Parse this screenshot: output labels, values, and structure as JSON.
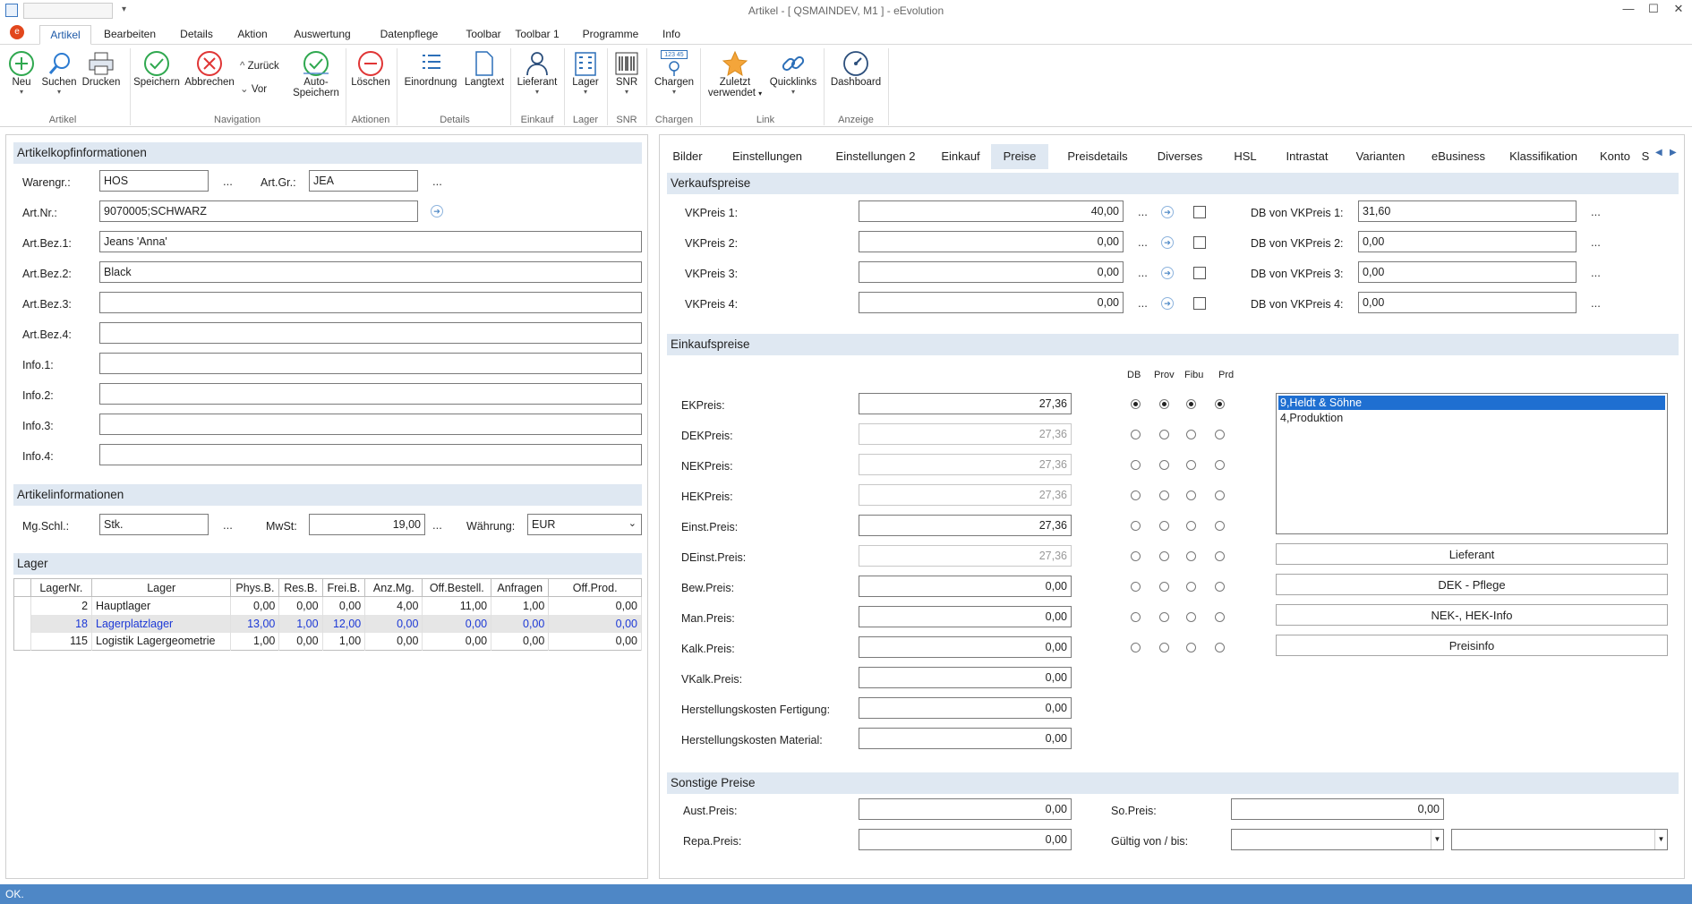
{
  "window": {
    "title": "Artikel - [ QSMAINDEV, M1 ] - eEvolution"
  },
  "ribbon_tabs": [
    "Artikel",
    "Bearbeiten",
    "Details",
    "Aktion",
    "Auswertung",
    "Datenpflege",
    "Toolbar",
    "Toolbar 1",
    "Programme",
    "Info"
  ],
  "ribbon": {
    "neu": "Neu",
    "suchen": "Suchen",
    "drucken": "Drucken",
    "speichern": "Speichern",
    "abbrechen": "Abbrechen",
    "zurueck": "Zurück",
    "vor": "Vor",
    "auto_speichern_1": "Auto-",
    "auto_speichern_2": "Speichern",
    "loeschen": "Löschen",
    "einordnung": "Einordnung",
    "langtext": "Langtext",
    "lieferant": "Lieferant",
    "lager": "Lager",
    "snr": "SNR",
    "chargen": "Chargen",
    "chargen_icon_text": "123 45",
    "zuletzt_1": "Zuletzt",
    "zuletzt_2": "verwendet",
    "quicklinks": "Quicklinks",
    "dashboard": "Dashboard",
    "groups": {
      "artikel": "Artikel",
      "navigation": "Navigation",
      "aktionen": "Aktionen",
      "details": "Details",
      "einkauf": "Einkauf",
      "lager": "Lager",
      "snr": "SNR",
      "chargen": "Chargen",
      "link": "Link",
      "anzeige": "Anzeige"
    }
  },
  "kopf": {
    "title": "Artikelkopfinformationen",
    "warengr_label": "Warengr.:",
    "warengr": "HOS",
    "artgr_label": "Art.Gr.:",
    "artgr": "JEA",
    "artnr_label": "Art.Nr.:",
    "artnr": "9070005;SCHWARZ",
    "bez1_label": "Art.Bez.1:",
    "bez1": "Jeans 'Anna'",
    "bez2_label": "Art.Bez.2:",
    "bez2": "Black",
    "bez3_label": "Art.Bez.3:",
    "bez3": "",
    "bez4_label": "Art.Bez.4:",
    "bez4": "",
    "info1_label": "Info.1:",
    "info1": "",
    "info2_label": "Info.2:",
    "info2": "",
    "info3_label": "Info.3:",
    "info3": "",
    "info4_label": "Info.4:",
    "info4": "",
    "dots": "..."
  },
  "artinfo": {
    "title": "Artikelinformationen",
    "mgschl_label": "Mg.Schl.:",
    "mgschl": "Stk.",
    "mwst_label": "MwSt:",
    "mwst": "19,00",
    "waehrung_label": "Währung:",
    "waehrung": "EUR"
  },
  "lager": {
    "title": "Lager",
    "columns": [
      "LagerNr.",
      "Lager",
      "Phys.B.",
      "Res.B.",
      "Frei.B.",
      "Anz.Mg.",
      "Off.Bestell.",
      "Anfragen",
      "Off.Prod."
    ],
    "rows": [
      [
        "2",
        "Hauptlager",
        "0,00",
        "0,00",
        "0,00",
        "4,00",
        "11,00",
        "1,00",
        "0,00"
      ],
      [
        "18",
        "Lagerplatzlager",
        "13,00",
        "1,00",
        "12,00",
        "0,00",
        "0,00",
        "0,00",
        "0,00"
      ],
      [
        "115",
        "Logistik Lagergeometrie",
        "1,00",
        "0,00",
        "1,00",
        "0,00",
        "0,00",
        "0,00",
        "0,00"
      ]
    ]
  },
  "right_tabs": [
    "Bilder",
    "Einstellungen",
    "Einstellungen 2",
    "Einkauf",
    "Preise",
    "Preisdetails",
    "Diverses",
    "HSL",
    "Intrastat",
    "Varianten",
    "eBusiness",
    "Klassifikation",
    "Konto",
    "S"
  ],
  "vk": {
    "title": "Verkaufspreise",
    "rows": [
      {
        "label": "VKPreis 1:",
        "value": "40,00",
        "db_label": "DB von VKPreis 1:",
        "db": "31,60"
      },
      {
        "label": "VKPreis 2:",
        "value": "0,00",
        "db_label": "DB von VKPreis 2:",
        "db": "0,00"
      },
      {
        "label": "VKPreis 3:",
        "value": "0,00",
        "db_label": "DB von VKPreis 3:",
        "db": "0,00"
      },
      {
        "label": "VKPreis 4:",
        "value": "0,00",
        "db_label": "DB von VKPreis 4:",
        "db": "0,00"
      }
    ]
  },
  "ek": {
    "title": "Einkaufspreise",
    "col_headers": [
      "DB",
      "Prov",
      "Fibu",
      "Prd"
    ],
    "rows": [
      {
        "label": "EKPreis:",
        "value": "27,36"
      },
      {
        "label": "DEKPreis:",
        "value": "27,36"
      },
      {
        "label": "NEKPreis:",
        "value": "27,36"
      },
      {
        "label": "HEKPreis:",
        "value": "27,36"
      },
      {
        "label": "Einst.Preis:",
        "value": "27,36"
      },
      {
        "label": "DEinst.Preis:",
        "value": "27,36"
      },
      {
        "label": "Bew.Preis:",
        "value": "0,00"
      },
      {
        "label": "Man.Preis:",
        "value": "0,00"
      },
      {
        "label": "Kalk.Preis:",
        "value": "0,00"
      },
      {
        "label": "VKalk.Preis:",
        "value": "0,00"
      },
      {
        "label": "Herstellungskosten Fertigung:",
        "value": "0,00"
      },
      {
        "label": "Herstellungskosten Material:",
        "value": "0,00"
      }
    ],
    "suppliers": [
      "9,Heldt & Söhne",
      "4,Produktion"
    ],
    "buttons": [
      "Lieferant",
      "DEK - Pflege",
      "NEK-, HEK-Info",
      "Preisinfo"
    ]
  },
  "sonstige": {
    "title": "Sonstige Preise",
    "aust_label": "Aust.Preis:",
    "aust": "0,00",
    "repa_label": "Repa.Preis:",
    "repa": "0,00",
    "so_label": "So.Preis:",
    "so": "0,00",
    "gueltig_label": "Gültig von / bis:"
  },
  "status": {
    "text": "OK."
  }
}
